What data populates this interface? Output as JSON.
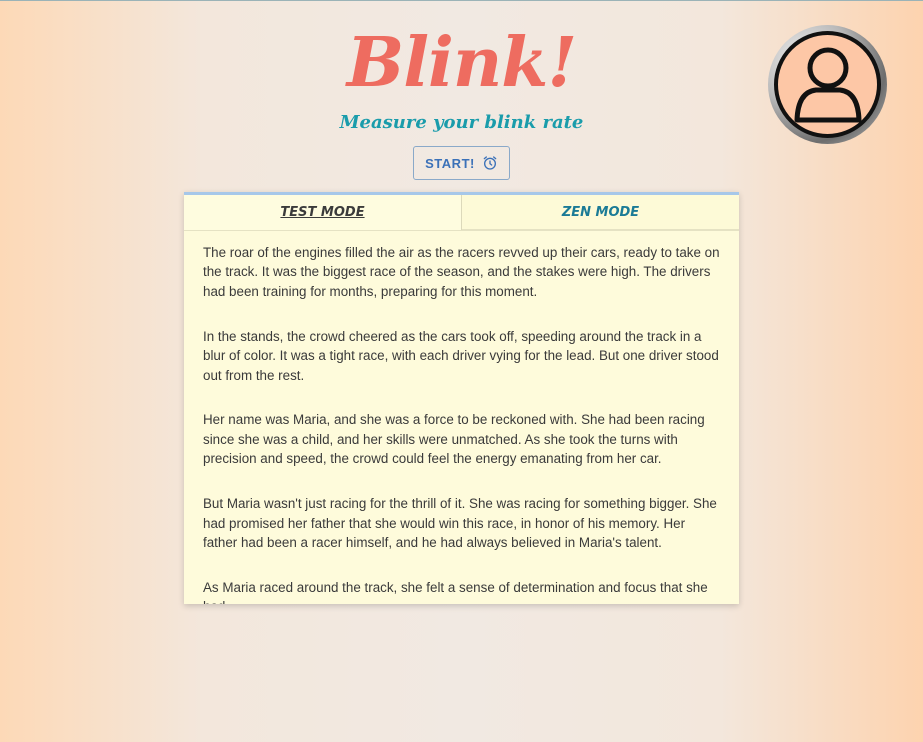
{
  "header": {
    "logo": "Blink!",
    "tagline": "Measure your blink rate",
    "start_label": "START!"
  },
  "icons": {
    "start": "alarm-clock-icon",
    "profile": "user-avatar-icon"
  },
  "colors": {
    "logo": "#ee6c60",
    "tagline": "#1a9cab",
    "button_text": "#3b71b8",
    "card_background": "#fefbdb",
    "card_accent": "#a6c7e9",
    "avatar_fill": "#fdc7a6"
  },
  "tabs": [
    {
      "label": "TEST MODE",
      "active": true
    },
    {
      "label": "ZEN MODE",
      "active": false
    }
  ],
  "story": {
    "paragraphs": [
      "The roar of the engines filled the air as the racers revved up their cars, ready to take on the track. It was the biggest race of the season, and the stakes were high. The drivers had been training for months, preparing for this moment.",
      "In the stands, the crowd cheered as the cars took off, speeding around the track in a blur of color. It was a tight race, with each driver vying for the lead. But one driver stood out from the rest.",
      "Her name was Maria, and she was a force to be reckoned with. She had been racing since she was a child, and her skills were unmatched. As she took the turns with precision and speed, the crowd could feel the energy emanating from her car.",
      "But Maria wasn't just racing for the thrill of it. She was racing for something bigger. She had promised her father that she would win this race, in honor of his memory. Her father had been a racer himself, and he had always believed in Maria's talent.",
      "As Maria raced around the track, she felt a sense of determination and focus that she had"
    ]
  }
}
